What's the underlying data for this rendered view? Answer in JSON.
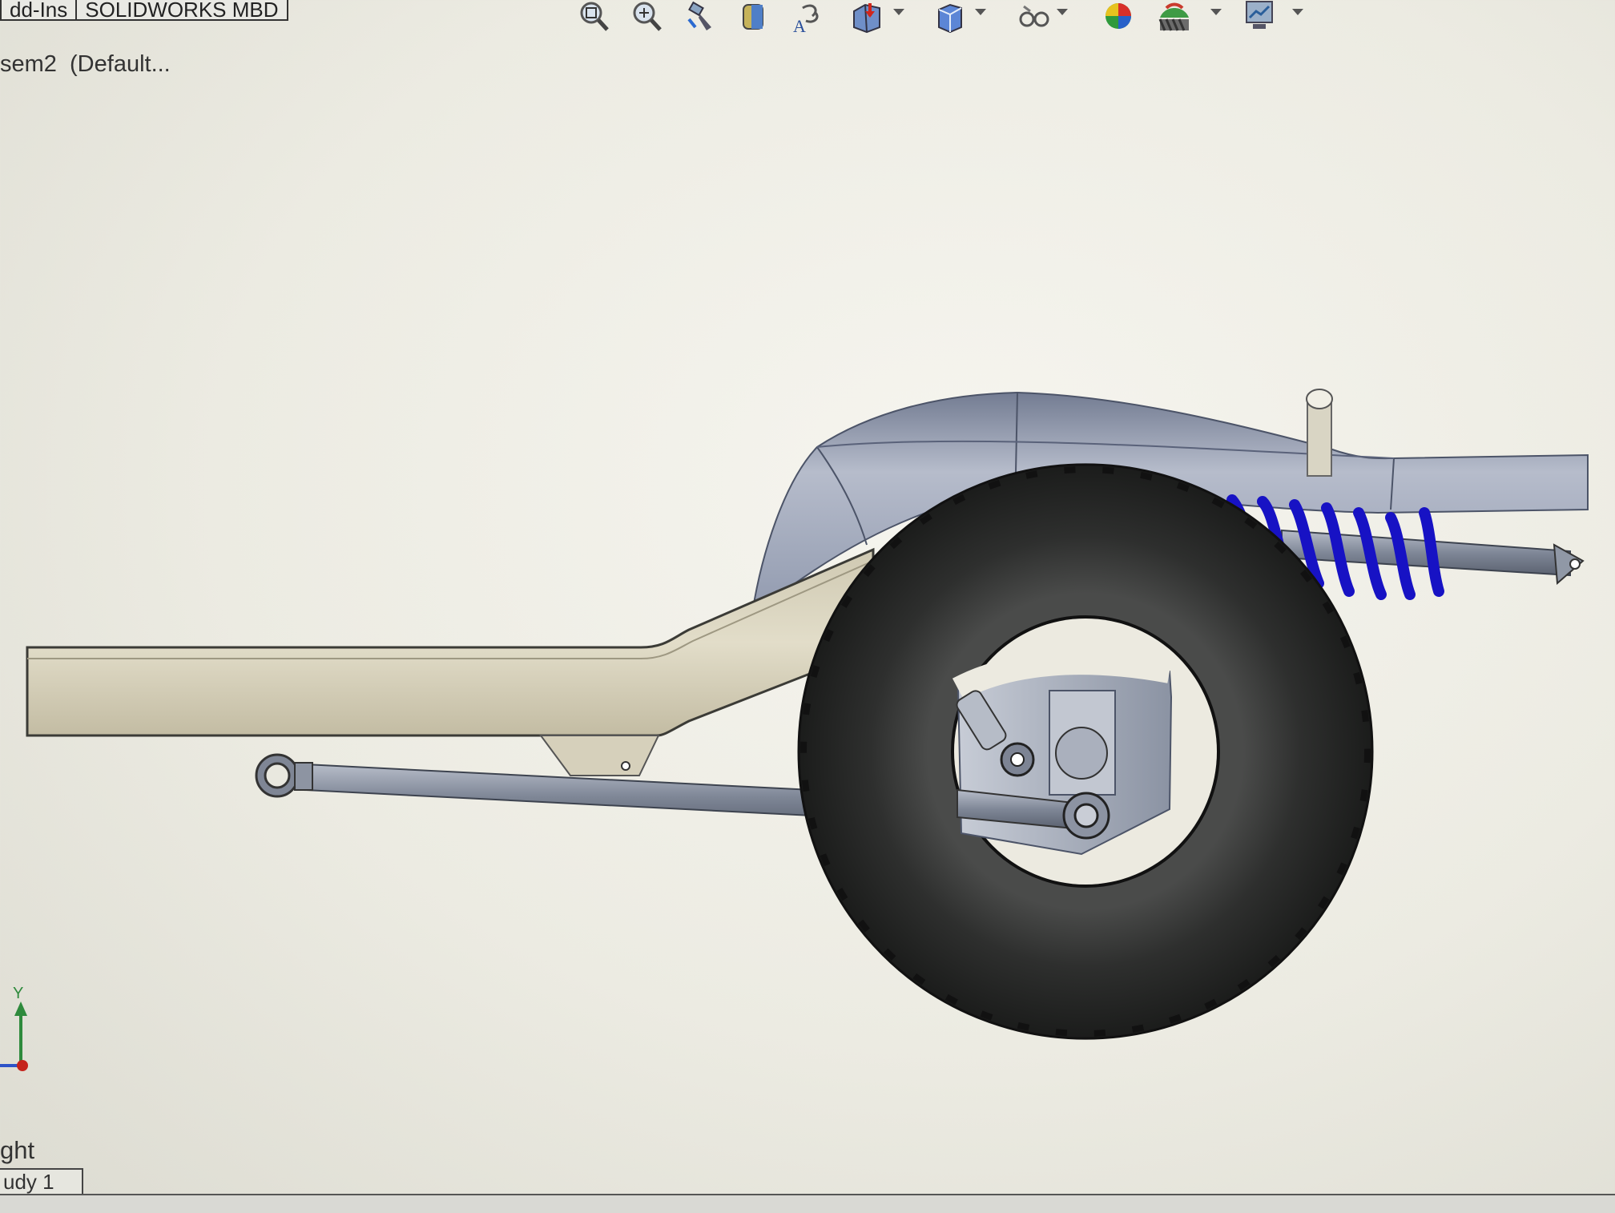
{
  "command_tabs": [
    "dd-Ins",
    "SOLIDWORKS MBD"
  ],
  "view_toolbar": {
    "buttons": [
      "zoom-to-fit-icon",
      "zoom-to-area-icon",
      "previous-view-icon",
      "section-view-icon",
      "dynamic-annotation-views-icon",
      "view-orientation-icon",
      "display-style-icon",
      "hide-show-items-icon",
      "edit-appearance-icon",
      "apply-scene-icon",
      "view-settings-icon"
    ]
  },
  "feature_tree": {
    "document_label": "sem2  (Default..."
  },
  "triad": {
    "y_label": "Y"
  },
  "view": {
    "name": "ght"
  },
  "bottom_tabs": [
    "udy 1"
  ],
  "colors": {
    "frame": "#d8d3bf",
    "fender": "#9aa3b6",
    "tire": "#2b2c2b",
    "spring": "#1612c8",
    "link": "#8f96a3"
  }
}
